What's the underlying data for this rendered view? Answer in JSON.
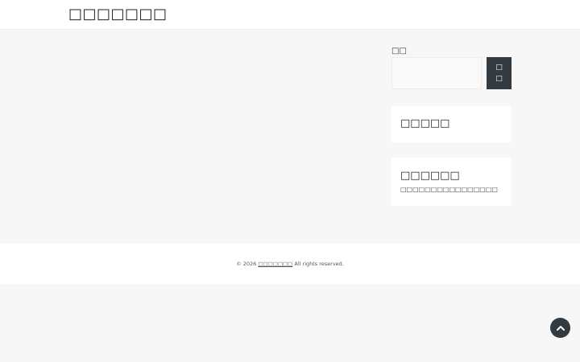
{
  "header": {
    "site_title": "□□□□□□□"
  },
  "sidebar": {
    "search": {
      "label": "□□",
      "value": "",
      "button_label": "□□"
    },
    "widgets": [
      {
        "title": "□□□□□"
      },
      {
        "title": "□□□□□□",
        "text": "□□□□□□□□□□□□□□□□"
      }
    ]
  },
  "footer": {
    "copyright_prefix": "© 2026",
    "site_link": "□□□□□□□",
    "copyright_suffix": "All rights reserved."
  },
  "icons": {
    "to_top": "chevron-up-icon"
  },
  "colors": {
    "button_bg": "#333a40",
    "page_bg": "#f7f7f7"
  }
}
